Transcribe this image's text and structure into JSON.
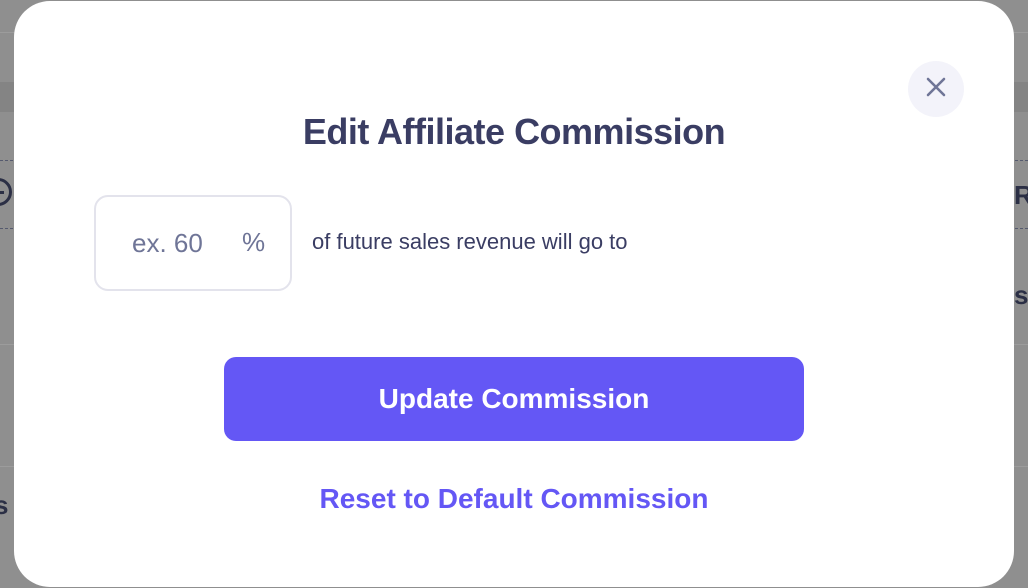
{
  "modal": {
    "title": "Edit Affiliate Commission",
    "close_icon": "close-icon",
    "commission_input": {
      "value": "",
      "placeholder": "ex. 60",
      "suffix": "%"
    },
    "sentence": "of future sales revenue will go to",
    "primary_button": "Update Commission",
    "reset_link": "Reset to Default Commission"
  },
  "background": {
    "partial_glyphs": [
      "R",
      "s",
      "s"
    ]
  },
  "colors": {
    "accent": "#6457f5",
    "title_text": "#3a3d63",
    "close_button_bg": "#f3f3fa",
    "input_border": "#e3e3ec",
    "overlay": "#8f8f8f"
  }
}
